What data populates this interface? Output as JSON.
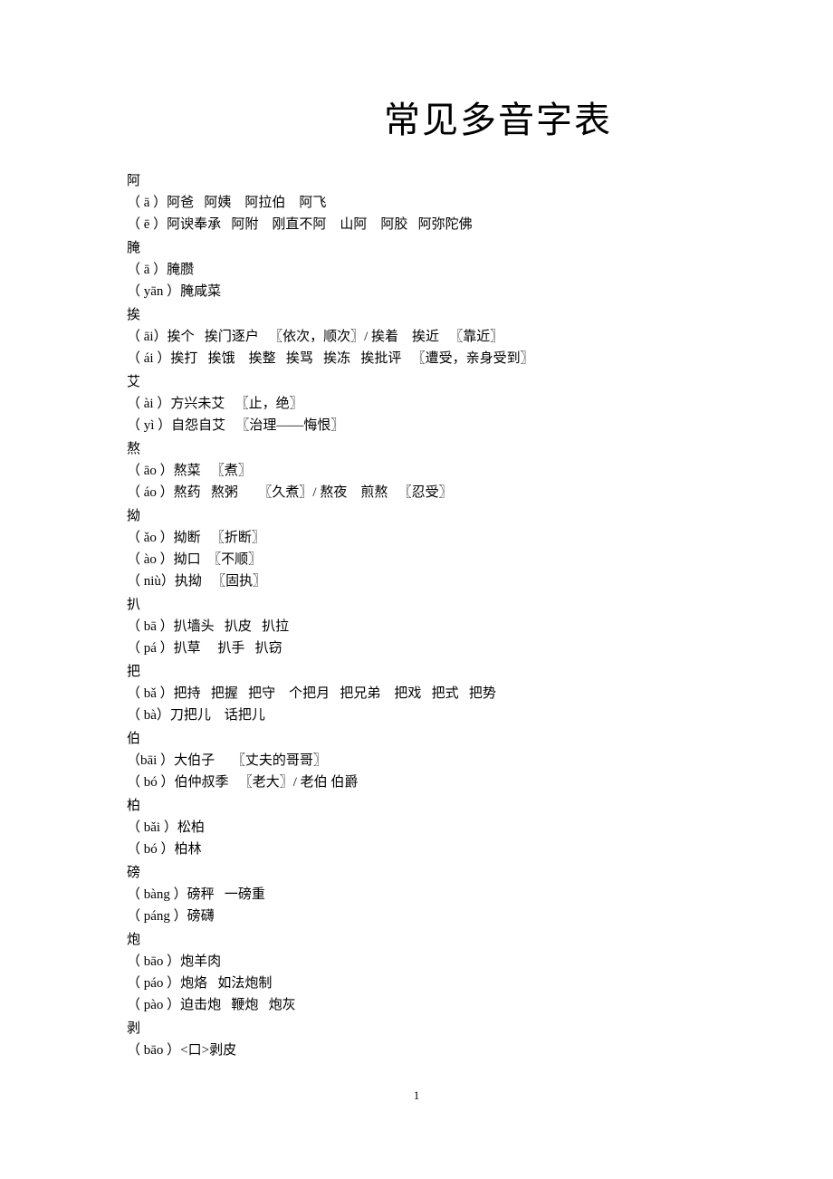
{
  "title": "常见多音字表",
  "page_number": "1",
  "entries": [
    {
      "char": "阿",
      "readings": [
        "（ ā ）阿爸   阿姨    阿拉伯    阿飞",
        "（ ē ）阿谀奉承   阿附    刚直不阿    山阿    阿胶   阿弥陀佛"
      ]
    },
    {
      "char": "腌",
      "readings": [
        "（ ā ）腌臜",
        "（ yān ）腌咸菜"
      ]
    },
    {
      "char": "挨",
      "readings": [
        "（ āi）挨个   挨门逐户   〖依次，顺次〗/ 挨着    挨近   〖靠近〗",
        "（ ái ）挨打   挨饿    挨整   挨骂   挨冻   挨批评   〖遭受，亲身受到〗"
      ]
    },
    {
      "char": "艾",
      "readings": [
        "（ ài ）方兴未艾   〖止，绝〗",
        "（ yì ）自怨自艾   〖治理——悔恨〗"
      ]
    },
    {
      "char": "熬",
      "readings": [
        "（ āo ）熬菜   〖煮〗",
        "（ áo ）熬药   熬粥      〖久煮〗/ 熬夜    煎熬   〖忍受〗"
      ]
    },
    {
      "char": "拗",
      "readings": [
        "（ ǎo ）拗断   〖折断〗",
        "（ ào ）拗口  〖不顺〗",
        "（ niù）执拗   〖固执〗"
      ]
    },
    {
      "char": "扒",
      "readings": [
        "（ bā ）扒墙头   扒皮   扒拉",
        "（ pá ）扒草     扒手   扒窃"
      ]
    },
    {
      "char": "把",
      "readings": [
        "（ bǎ ）把持   把握   把守    个把月   把兄弟    把戏   把式   把势",
        "（ bà）刀把儿    话把儿"
      ]
    },
    {
      "char": "伯",
      "readings": [
        "（bāi ）大伯子     〖丈夫的哥哥〗",
        "（ bó ）伯仲叔季   〖老大〗/ 老伯 伯爵"
      ]
    },
    {
      "char": "柏",
      "readings": [
        "（ bǎi ）松柏",
        "（ bó ）柏林"
      ]
    },
    {
      "char": "磅",
      "readings": [
        "（ bàng ）磅秤   一磅重",
        "（ páng ）磅礴"
      ]
    },
    {
      "char": "炮",
      "readings": [
        "（ bāo ）炮羊肉",
        "（ páo ）炮烙   如法炮制",
        "（ pào ）迫击炮   鞭炮   炮灰"
      ]
    },
    {
      "char": "剥",
      "readings": [
        "（ bāo ）<口>剥皮"
      ]
    }
  ]
}
